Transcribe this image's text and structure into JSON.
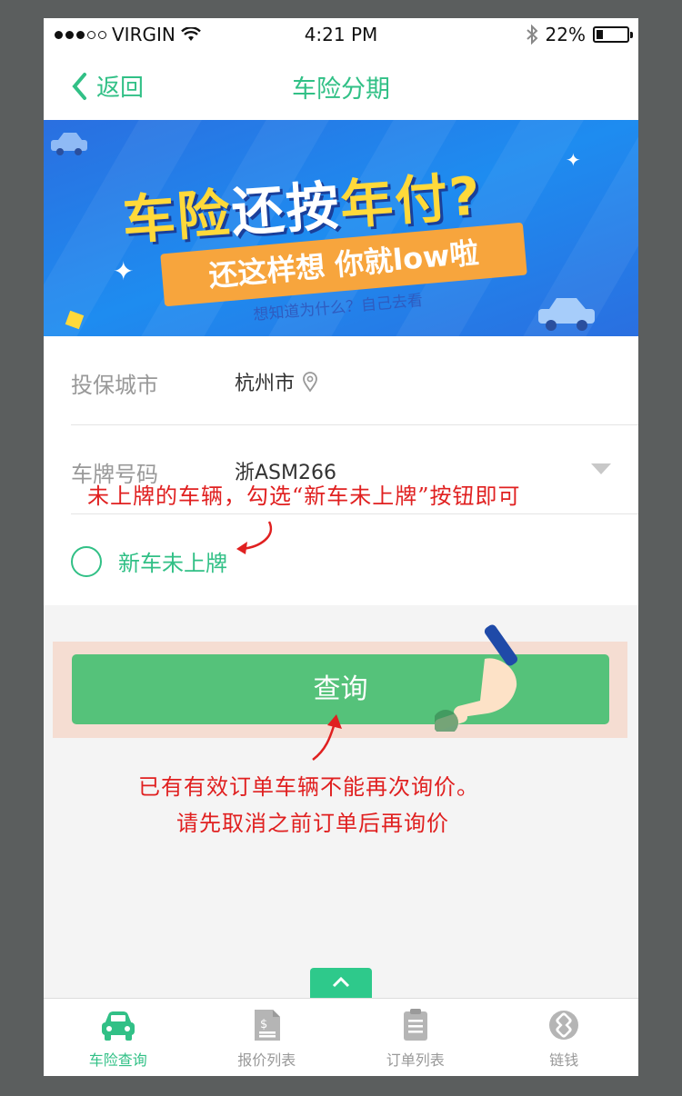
{
  "status": {
    "carrier": "VIRGIN",
    "time": "4:21 PM",
    "battery": "22%"
  },
  "nav": {
    "back_label": "返回",
    "title": "车险分期"
  },
  "banner": {
    "headline_a": "车险",
    "headline_b": "还按",
    "headline_c": "年付?",
    "ribbon": "还这样想 你就low啦",
    "sub": "想知道为什么？自己去看"
  },
  "form": {
    "city_label": "投保城市",
    "city_value": "杭州市",
    "plate_label": "车牌号码",
    "plate_value": "浙ASM266",
    "new_car_label": "新车未上牌"
  },
  "annotations": {
    "top": "未上牌的车辆，勾选“新车未上牌”按钮即可",
    "bottom_1": "已有有效订单车辆不能再次询价。",
    "bottom_2": "请先取消之前订单后再询价"
  },
  "query_button": "查询",
  "tabs": [
    {
      "label": "车险查询",
      "icon": "car-icon",
      "active": true
    },
    {
      "label": "报价列表",
      "icon": "quote-doc-icon",
      "active": false
    },
    {
      "label": "订单列表",
      "icon": "clipboard-icon",
      "active": false
    },
    {
      "label": "链钱",
      "icon": "chain-icon",
      "active": false
    }
  ],
  "colors": {
    "accent": "#31c086",
    "button": "#55c27a",
    "annotation": "#e02020"
  }
}
